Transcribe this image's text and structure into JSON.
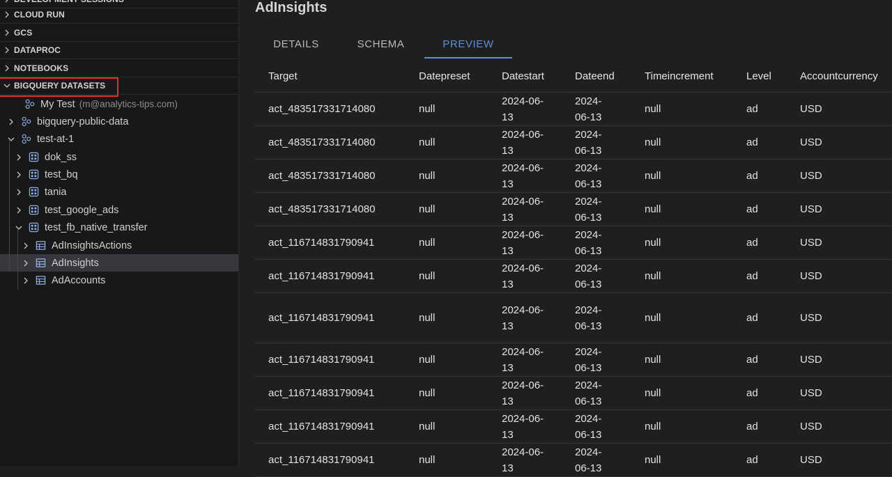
{
  "sidebar": {
    "sections": [
      {
        "label": "DEVELOPMENT SESSIONS",
        "expanded": false
      },
      {
        "label": "CLOUD RUN",
        "expanded": false
      },
      {
        "label": "GCS",
        "expanded": false
      },
      {
        "label": "DATAPROC",
        "expanded": false
      },
      {
        "label": "NOTEBOOKS",
        "expanded": false
      },
      {
        "label": "BIGQUERY DATASETS",
        "expanded": true
      }
    ],
    "tree": [
      {
        "label": "My Test",
        "sub": "(m@analytics-tips.com)",
        "icon": "project-icon"
      },
      {
        "label": "bigquery-public-data",
        "icon": "project-icon"
      },
      {
        "label": "test-at-1",
        "icon": "project-icon"
      },
      {
        "label": "dok_ss",
        "icon": "dataset-icon"
      },
      {
        "label": "test_bq",
        "icon": "dataset-icon"
      },
      {
        "label": "tania",
        "icon": "dataset-icon"
      },
      {
        "label": "test_google_ads",
        "icon": "dataset-icon"
      },
      {
        "label": "test_fb_native_transfer",
        "icon": "dataset-icon"
      },
      {
        "label": "AdInsightsActions",
        "icon": "table-icon"
      },
      {
        "label": "AdInsights",
        "icon": "table-icon",
        "selected": true
      },
      {
        "label": "AdAccounts",
        "icon": "table-icon"
      }
    ]
  },
  "main": {
    "title": "AdInsights",
    "tabs": [
      {
        "label": "DETAILS",
        "active": false
      },
      {
        "label": "SCHEMA",
        "active": false
      },
      {
        "label": "PREVIEW",
        "active": true
      }
    ],
    "columns": [
      "Target",
      "Datepreset",
      "Datestart",
      "Dateend",
      "Timeincrement",
      "Level",
      "Accountcurrency"
    ],
    "rows": [
      [
        "act_483517331714080",
        "null",
        "2024-06-13",
        "2024-06-13",
        "null",
        "ad",
        "USD"
      ],
      [
        "act_483517331714080",
        "null",
        "2024-06-13",
        "2024-06-13",
        "null",
        "ad",
        "USD"
      ],
      [
        "act_483517331714080",
        "null",
        "2024-06-13",
        "2024-06-13",
        "null",
        "ad",
        "USD"
      ],
      [
        "act_483517331714080",
        "null",
        "2024-06-13",
        "2024-06-13",
        "null",
        "ad",
        "USD"
      ],
      [
        "act_116714831790941",
        "null",
        "2024-06-13",
        "2024-06-13",
        "null",
        "ad",
        "USD"
      ],
      [
        "act_116714831790941",
        "null",
        "2024-06-13",
        "2024-06-13",
        "null",
        "ad",
        "USD"
      ],
      [
        "act_116714831790941",
        "null",
        "2024-06-13",
        "2024-06-13",
        "null",
        "ad",
        "USD"
      ],
      [
        "act_116714831790941",
        "null",
        "2024-06-13",
        "2024-06-13",
        "null",
        "ad",
        "USD"
      ],
      [
        "act_116714831790941",
        "null",
        "2024-06-13",
        "2024-06-13",
        "null",
        "ad",
        "USD"
      ],
      [
        "act_116714831790941",
        "null",
        "2024-06-13",
        "2024-06-13",
        "null",
        "ad",
        "USD"
      ],
      [
        "act_116714831790941",
        "null",
        "2024-06-13",
        "2024-06-13",
        "null",
        "ad",
        "USD"
      ]
    ]
  },
  "colors": {
    "accent": "#5f8fd6",
    "highlight": "#e03131",
    "icon": "#8fb0e8"
  }
}
